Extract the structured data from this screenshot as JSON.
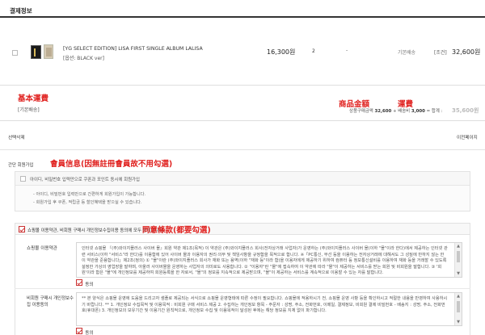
{
  "header": {
    "title": "결제정보"
  },
  "product": {
    "name": "[YG SELECT EDITION] LISA FIRST SINGLE ALBUM LALISA",
    "option": "[옵션: BLACK ver]",
    "price": "16,300원",
    "quantity": "2",
    "dash": "-",
    "shipping_type": "기본배송",
    "shipping_cond": "[조건]",
    "total": "32,600원"
  },
  "annotations": {
    "basic_shipping": "基本運費",
    "goods_amount": "商品金額",
    "shipping_fee": "運費",
    "member_info": "會員信息(因無註冊會員故不用勾選)",
    "agree_terms": "同意條款(都要勾選)"
  },
  "summary": {
    "shipping_label": "[기본배송]",
    "formula_prefix": "상품구매금액",
    "goods_amount": "32,600",
    "shipping_part": "+ 배송비",
    "shipping_amount": "3,000",
    "equals": "= 합계 :",
    "total": "35,600원"
  },
  "actions": {
    "delete_selected": "선택삭제",
    "prev_page": "이전페이지"
  },
  "member": {
    "section_label": "간단 회원가입",
    "checkbox_label": "아이디, 비밀번호 입력만으로 쿠폰과 포인트 동시에 회원가입",
    "bullets": [
      "- 아이디, 비밀번호 입력만으로 간편하게 회원가입이 가능합니다.",
      "- 회원가입 후 쿠폰, 적립금 등 할인혜택을 받으실 수 있습니다."
    ]
  },
  "terms": {
    "agree_all": "쇼핑몰 이용약관, 비회원 구매시 개인정보수집이용 동의에 모두 동의합니다.",
    "shop_terms_label": "쇼핑몰 이용약관",
    "shop_terms_text": "인터넷 쇼핑몰 『(주)와이지플러스 사이버 몰』회원 약관 제1조(목적) 이 약관은 (주)와이지플러스 회사(전자상거래 사업자)가 운영하는 (주)와이지플러스 사이버 몰(이하 \"몰\"이라 한다)에서 제공하는 인터넷 관련 서비스(이하 \"서비스\"라 한다)를 이용함에 있어 사이버 몰과 이용자의 권리·의무 및 책임사항을 규정함을 목적으로 합니다. ※「PC통신, 무선 등을 이용하는 전자상거래에 대해서도 그 성질에 반하지 않는 한 이 약관을 준용합니다」제2조(정의) ① \"몰\"이란 (주)와이지플러스 회사가 재화 또는 용역(이하 \"재화 등\"이라 함)을 이용자에게 제공하기 위하여 컴퓨터 등 정보통신설비를 이용하여 재화 등을 거래할 수 있도록 설정한 가상의 영업장을 말하며, 아울러 사이버몰을 운영하는 사업자의 의미로도 사용합니다. ② \"이용자\"란 \"몰\"에 접속하여 이 약관에 따라 \"몰\"이 제공하는 서비스를 받는 회원 및 비회원을 말합니다. ③ '회원'이라 함은 \"몰\"에 개인정보를 제공하여 회원등록을 한 자로서, \"몰\"의 정보를 지속적으로 제공받으며, \"몰\"이 제공하는 서비스를 계속적으로 이용할 수 있는 자를 말합니다.",
    "shop_agree": "동의",
    "privacy_label": "비회원 구매시 개인정보수집 이용동의",
    "privacy_text": "** 본 양식은 쇼핑몰 운영에 도움을 드리고자 샘플로 제공되는 서식으로 쇼핑몰 운영형태에 따른 수정이 필요합니다. 쇼핑몰에 적용하시기 전, 쇼핑몰 운영 사항 등을 확인하시고 적절한 내용을 반영하여 사용하시기 바랍니다. ** 1. 개인정보 수집목적 및 이용목적 : 비회원 구매 서비스 제공 2. 수집하는 개인정보 항목 - 주문자 : 성명, 주소, 전화번호, 이메일, 결제정보, 비회원 결제 비밀번호 - 배송지 : 성명, 주소, 전화번호(휴대폰) 3. 개인정보의 보유기간 및 이용기간 원칙적으로, 개인정보 수집 및 이용목적이 달성된 후에는 해당 정보를 지체 없이 파기합니다.",
    "privacy_agree": "동의"
  }
}
